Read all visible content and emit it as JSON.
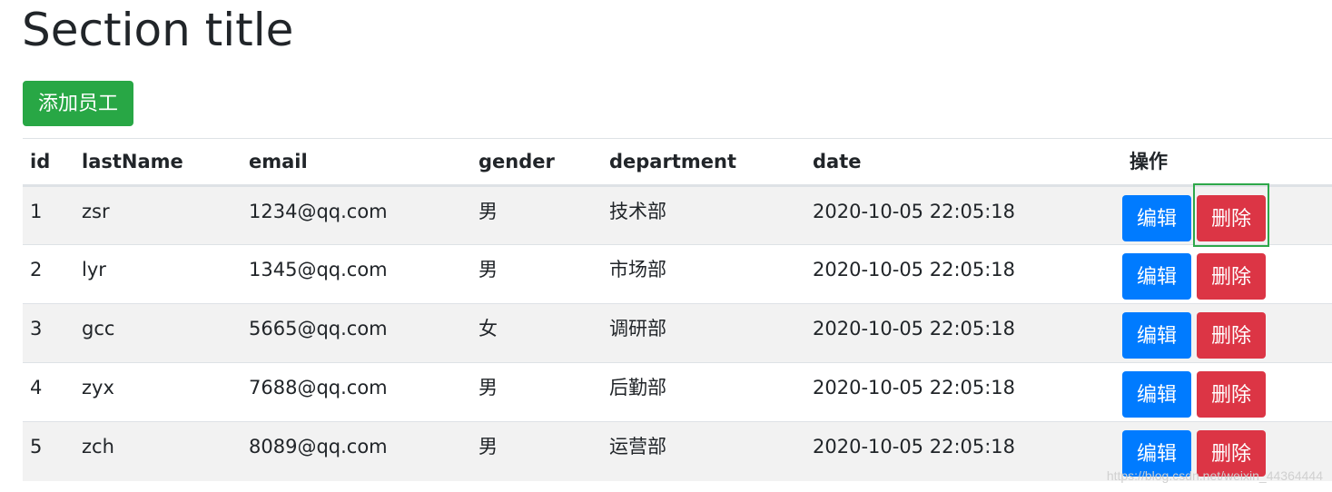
{
  "header": {
    "title": "Section title",
    "add_button_label": "添加员工"
  },
  "table": {
    "columns": [
      "id",
      "lastName",
      "email",
      "gender",
      "department",
      "date",
      "操作"
    ],
    "rows": [
      {
        "id": "1",
        "lastName": "zsr",
        "email": "1234@qq.com",
        "gender": "男",
        "department": "技术部",
        "date": "2020-10-05 22:05:18",
        "edit": "编辑",
        "delete": "删除"
      },
      {
        "id": "2",
        "lastName": "lyr",
        "email": "1345@qq.com",
        "gender": "男",
        "department": "市场部",
        "date": "2020-10-05 22:05:18",
        "edit": "编辑",
        "delete": "删除"
      },
      {
        "id": "3",
        "lastName": "gcc",
        "email": "5665@qq.com",
        "gender": "女",
        "department": "调研部",
        "date": "2020-10-05 22:05:18",
        "edit": "编辑",
        "delete": "删除"
      },
      {
        "id": "4",
        "lastName": "zyx",
        "email": "7688@qq.com",
        "gender": "男",
        "department": "后勤部",
        "date": "2020-10-05 22:05:18",
        "edit": "编辑",
        "delete": "删除"
      },
      {
        "id": "5",
        "lastName": "zch",
        "email": "8089@qq.com",
        "gender": "男",
        "department": "运营部",
        "date": "2020-10-05 22:05:18",
        "edit": "编辑",
        "delete": "删除"
      }
    ]
  },
  "watermark": "https://blog.csdn.net/weixin_44364444",
  "colors": {
    "success": "#28a745",
    "primary": "#007bff",
    "danger": "#dc3545",
    "stripe": "#f2f2f2",
    "focus_ring": "#2ea84a"
  }
}
